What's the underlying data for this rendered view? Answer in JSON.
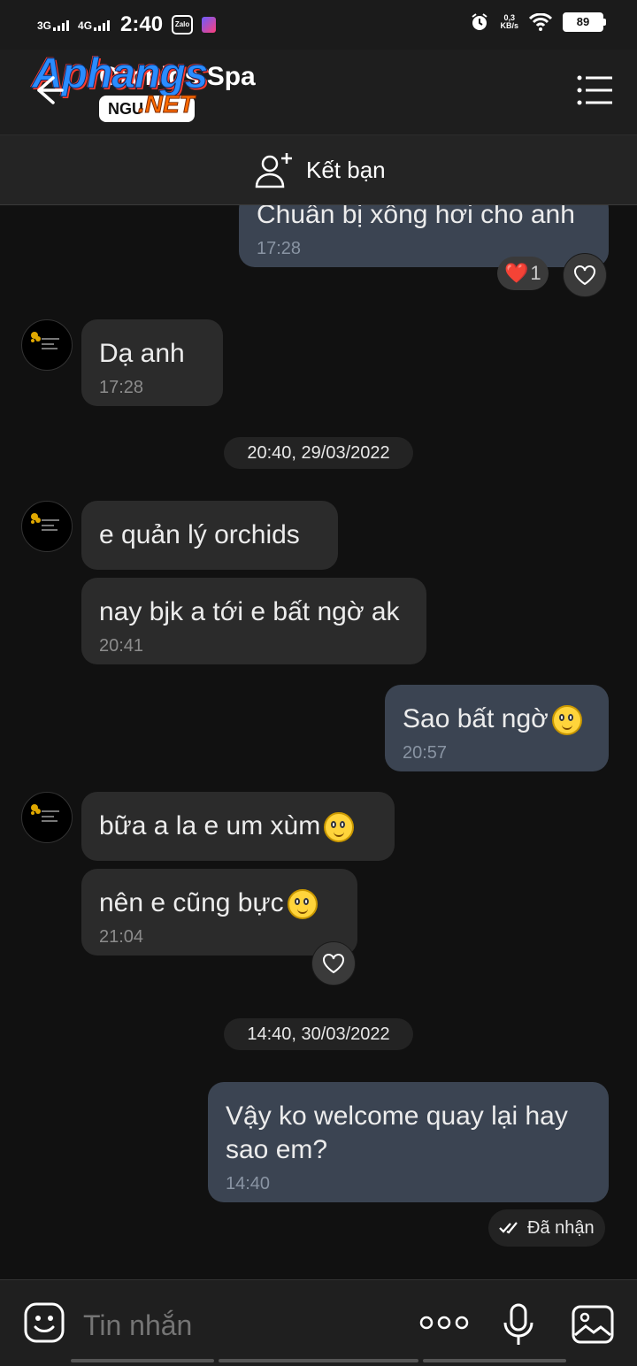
{
  "status_bar": {
    "signal1": "3G",
    "signal2": "4G",
    "time": "2:40",
    "zalo_label": "Zalo",
    "speed_value": "0,3",
    "speed_unit": "KB/s",
    "battery": "89",
    "icons": [
      "alarm-icon",
      "wifi-icon",
      "battery-icon"
    ]
  },
  "header": {
    "title": "Orchids Spa",
    "watermark": {
      "brand": "Aphangs",
      "badge": "NGU",
      "suffix": ".NET"
    }
  },
  "add_friend": {
    "label": "Kết bạn"
  },
  "messages": [
    {
      "id": "m1",
      "direction": "out",
      "text": "Chuẩn bị xông hơi cho anh",
      "time": "17:28",
      "reaction": "❤️",
      "reaction_count": "1"
    },
    {
      "id": "m2",
      "direction": "in",
      "text": "Dạ anh",
      "time": "17:28"
    },
    {
      "id": "d1",
      "type": "date",
      "text": "20:40, 29/03/2022"
    },
    {
      "id": "m3",
      "direction": "in",
      "text": "e quản lý orchids"
    },
    {
      "id": "m4",
      "direction": "in",
      "text": "nay bjk a tới e bất ngờ ak",
      "time": "20:41"
    },
    {
      "id": "m5",
      "direction": "out",
      "text": "Sao bất ngờ",
      "emoji": "smiling-face",
      "time": "20:57"
    },
    {
      "id": "m6",
      "direction": "in",
      "text": "bữa a la e um xùm",
      "emoji": "smiling-face"
    },
    {
      "id": "m7",
      "direction": "in",
      "text": "nên e cũng bực",
      "emoji": "smiling-face",
      "time": "21:04"
    },
    {
      "id": "d2",
      "type": "date",
      "text": "14:40, 30/03/2022"
    },
    {
      "id": "m8",
      "direction": "out",
      "text": "Vậy ko welcome quay lại hay sao em?",
      "time": "14:40"
    }
  ],
  "delivery_status": "Đã nhận",
  "input": {
    "placeholder": "Tin nhắn"
  },
  "colors": {
    "background": "#111111",
    "incoming_bubble": "#2b2b2b",
    "outgoing_bubble": "#3b4452"
  }
}
